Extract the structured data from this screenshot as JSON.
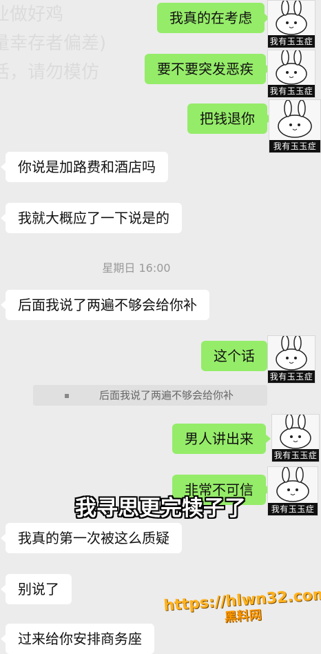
{
  "background_overlay": {
    "lines": [
      "业做好鸡",
      "量幸存者偏差)",
      "活，请勿模仿"
    ]
  },
  "avatar": {
    "label": "我有玉玉症",
    "icon": "rabbit-meme-icon"
  },
  "messages": [
    {
      "sender": "me",
      "text": "我真的在考虑"
    },
    {
      "sender": "me",
      "text": "要不要突发恶疾"
    },
    {
      "sender": "me",
      "text": "把钱退你"
    },
    {
      "sender": "them",
      "text": "你说是加路费和酒店吗"
    },
    {
      "sender": "them",
      "text": "我就大概应了一下说是的"
    },
    {
      "sender": "them",
      "text": "后面我说了两遍不够会给你补"
    },
    {
      "sender": "me",
      "text": "这个话"
    },
    {
      "sender": "me",
      "text": "男人讲出来"
    },
    {
      "sender": "me",
      "text": "非常不可信"
    },
    {
      "sender": "them",
      "text": "我真的第一次被这么质疑"
    },
    {
      "sender": "them",
      "text": "别说了"
    },
    {
      "sender": "them",
      "text": "过来给你安排商务座"
    }
  ],
  "timestamp": "星期日 16:00",
  "quote": {
    "text": "后面我说了两遍不够会给你补"
  },
  "subtitle": "我寻思更完犊子了",
  "site_watermark": {
    "url": "https://hlwn32.com",
    "name": "黑料网"
  },
  "colors": {
    "my_bubble": "#95ec69",
    "their_bubble": "#ffffff",
    "chat_background": "#ececec"
  }
}
